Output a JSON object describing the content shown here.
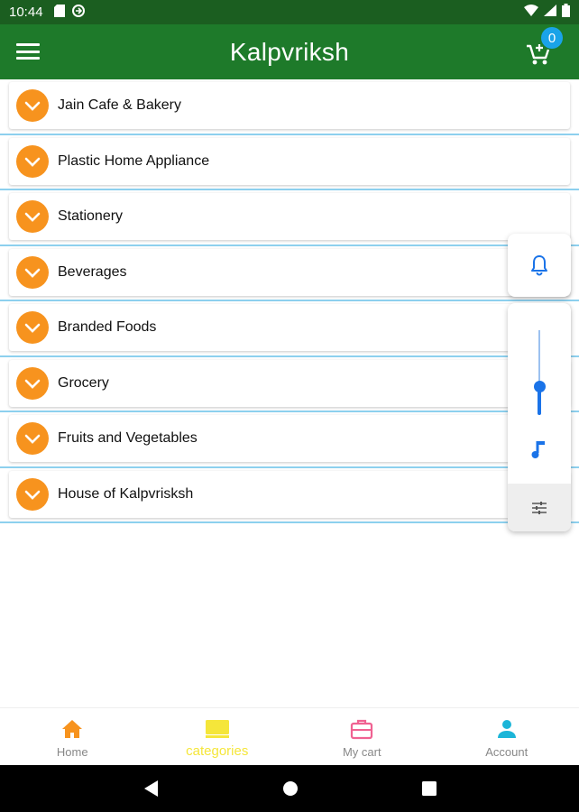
{
  "status_bar": {
    "time": "10:44"
  },
  "app_bar": {
    "title": "Kalpvriksh",
    "cart_count": "0"
  },
  "categories": [
    {
      "label": "Jain Cafe & Bakery"
    },
    {
      "label": "Plastic Home Appliance"
    },
    {
      "label": "Stationery"
    },
    {
      "label": "Beverages"
    },
    {
      "label": "Branded Foods"
    },
    {
      "label": "Grocery"
    },
    {
      "label": "Fruits and Vegetables"
    },
    {
      "label": "House of Kalpvrisksh"
    }
  ],
  "volume_overlay": {
    "level": 0.35
  },
  "bottom_nav": {
    "items": [
      {
        "label": "Home",
        "icon": "home-icon"
      },
      {
        "label": "categories",
        "icon": "categories-icon",
        "active": true
      },
      {
        "label": "My cart",
        "icon": "briefcase-icon"
      },
      {
        "label": "Account",
        "icon": "account-icon"
      }
    ]
  },
  "colors": {
    "status_bar": "#1b5e20",
    "app_bar": "#1e7a2a",
    "chevron": "#f7931e",
    "badge": "#1aa3e8",
    "active_tab": "#f5e63a",
    "separator": "#8dd0ee"
  }
}
